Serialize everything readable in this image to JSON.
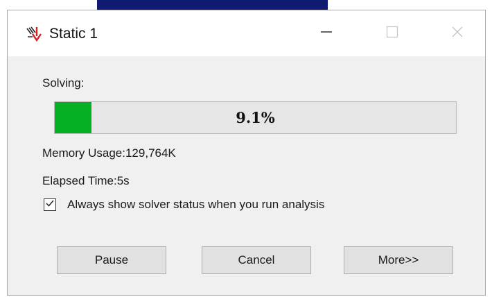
{
  "window": {
    "title": "Static 1",
    "app_icon": "solver-app-icon",
    "controls": {
      "minimize": "minimize-icon",
      "maximize": "maximize-icon",
      "close": "close-icon"
    }
  },
  "status": {
    "solving_label": "Solving:",
    "progress_percent": 9.1,
    "progress_text": "9.1%",
    "memory_text": "Memory Usage:129,764K",
    "elapsed_text": "Elapsed Time:5s"
  },
  "options": {
    "always_show_label": "Always show solver status when you run analysis",
    "always_show_checked": true
  },
  "buttons": {
    "pause": "Pause",
    "cancel": "Cancel",
    "more": "More>>"
  },
  "colors": {
    "progress_fill": "#06b025",
    "progress_track": "#e6e6e6",
    "window_bg": "#f0f0f0"
  }
}
